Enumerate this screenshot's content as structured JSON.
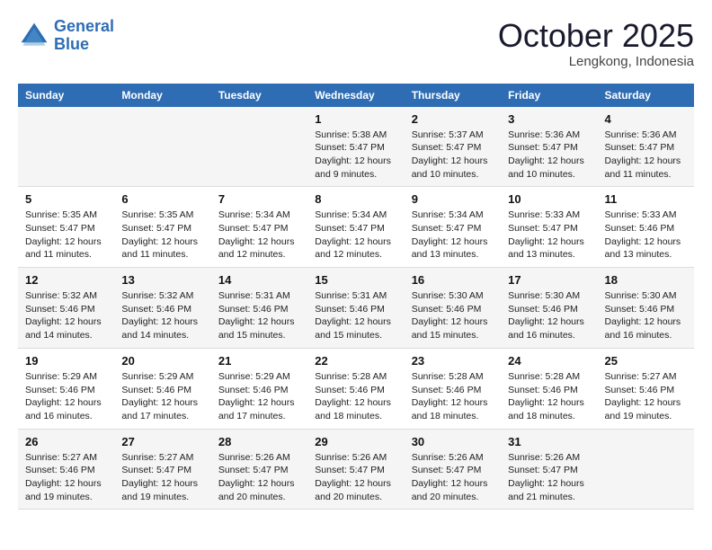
{
  "header": {
    "logo_line1": "General",
    "logo_line2": "Blue",
    "month": "October 2025",
    "location": "Lengkong, Indonesia"
  },
  "weekdays": [
    "Sunday",
    "Monday",
    "Tuesday",
    "Wednesday",
    "Thursday",
    "Friday",
    "Saturday"
  ],
  "weeks": [
    [
      {
        "day": "",
        "info": ""
      },
      {
        "day": "",
        "info": ""
      },
      {
        "day": "",
        "info": ""
      },
      {
        "day": "1",
        "info": "Sunrise: 5:38 AM\nSunset: 5:47 PM\nDaylight: 12 hours\nand 9 minutes."
      },
      {
        "day": "2",
        "info": "Sunrise: 5:37 AM\nSunset: 5:47 PM\nDaylight: 12 hours\nand 10 minutes."
      },
      {
        "day": "3",
        "info": "Sunrise: 5:36 AM\nSunset: 5:47 PM\nDaylight: 12 hours\nand 10 minutes."
      },
      {
        "day": "4",
        "info": "Sunrise: 5:36 AM\nSunset: 5:47 PM\nDaylight: 12 hours\nand 11 minutes."
      }
    ],
    [
      {
        "day": "5",
        "info": "Sunrise: 5:35 AM\nSunset: 5:47 PM\nDaylight: 12 hours\nand 11 minutes."
      },
      {
        "day": "6",
        "info": "Sunrise: 5:35 AM\nSunset: 5:47 PM\nDaylight: 12 hours\nand 11 minutes."
      },
      {
        "day": "7",
        "info": "Sunrise: 5:34 AM\nSunset: 5:47 PM\nDaylight: 12 hours\nand 12 minutes."
      },
      {
        "day": "8",
        "info": "Sunrise: 5:34 AM\nSunset: 5:47 PM\nDaylight: 12 hours\nand 12 minutes."
      },
      {
        "day": "9",
        "info": "Sunrise: 5:34 AM\nSunset: 5:47 PM\nDaylight: 12 hours\nand 13 minutes."
      },
      {
        "day": "10",
        "info": "Sunrise: 5:33 AM\nSunset: 5:47 PM\nDaylight: 12 hours\nand 13 minutes."
      },
      {
        "day": "11",
        "info": "Sunrise: 5:33 AM\nSunset: 5:46 PM\nDaylight: 12 hours\nand 13 minutes."
      }
    ],
    [
      {
        "day": "12",
        "info": "Sunrise: 5:32 AM\nSunset: 5:46 PM\nDaylight: 12 hours\nand 14 minutes."
      },
      {
        "day": "13",
        "info": "Sunrise: 5:32 AM\nSunset: 5:46 PM\nDaylight: 12 hours\nand 14 minutes."
      },
      {
        "day": "14",
        "info": "Sunrise: 5:31 AM\nSunset: 5:46 PM\nDaylight: 12 hours\nand 15 minutes."
      },
      {
        "day": "15",
        "info": "Sunrise: 5:31 AM\nSunset: 5:46 PM\nDaylight: 12 hours\nand 15 minutes."
      },
      {
        "day": "16",
        "info": "Sunrise: 5:30 AM\nSunset: 5:46 PM\nDaylight: 12 hours\nand 15 minutes."
      },
      {
        "day": "17",
        "info": "Sunrise: 5:30 AM\nSunset: 5:46 PM\nDaylight: 12 hours\nand 16 minutes."
      },
      {
        "day": "18",
        "info": "Sunrise: 5:30 AM\nSunset: 5:46 PM\nDaylight: 12 hours\nand 16 minutes."
      }
    ],
    [
      {
        "day": "19",
        "info": "Sunrise: 5:29 AM\nSunset: 5:46 PM\nDaylight: 12 hours\nand 16 minutes."
      },
      {
        "day": "20",
        "info": "Sunrise: 5:29 AM\nSunset: 5:46 PM\nDaylight: 12 hours\nand 17 minutes."
      },
      {
        "day": "21",
        "info": "Sunrise: 5:29 AM\nSunset: 5:46 PM\nDaylight: 12 hours\nand 17 minutes."
      },
      {
        "day": "22",
        "info": "Sunrise: 5:28 AM\nSunset: 5:46 PM\nDaylight: 12 hours\nand 18 minutes."
      },
      {
        "day": "23",
        "info": "Sunrise: 5:28 AM\nSunset: 5:46 PM\nDaylight: 12 hours\nand 18 minutes."
      },
      {
        "day": "24",
        "info": "Sunrise: 5:28 AM\nSunset: 5:46 PM\nDaylight: 12 hours\nand 18 minutes."
      },
      {
        "day": "25",
        "info": "Sunrise: 5:27 AM\nSunset: 5:46 PM\nDaylight: 12 hours\nand 19 minutes."
      }
    ],
    [
      {
        "day": "26",
        "info": "Sunrise: 5:27 AM\nSunset: 5:46 PM\nDaylight: 12 hours\nand 19 minutes."
      },
      {
        "day": "27",
        "info": "Sunrise: 5:27 AM\nSunset: 5:47 PM\nDaylight: 12 hours\nand 19 minutes."
      },
      {
        "day": "28",
        "info": "Sunrise: 5:26 AM\nSunset: 5:47 PM\nDaylight: 12 hours\nand 20 minutes."
      },
      {
        "day": "29",
        "info": "Sunrise: 5:26 AM\nSunset: 5:47 PM\nDaylight: 12 hours\nand 20 minutes."
      },
      {
        "day": "30",
        "info": "Sunrise: 5:26 AM\nSunset: 5:47 PM\nDaylight: 12 hours\nand 20 minutes."
      },
      {
        "day": "31",
        "info": "Sunrise: 5:26 AM\nSunset: 5:47 PM\nDaylight: 12 hours\nand 21 minutes."
      },
      {
        "day": "",
        "info": ""
      }
    ]
  ]
}
